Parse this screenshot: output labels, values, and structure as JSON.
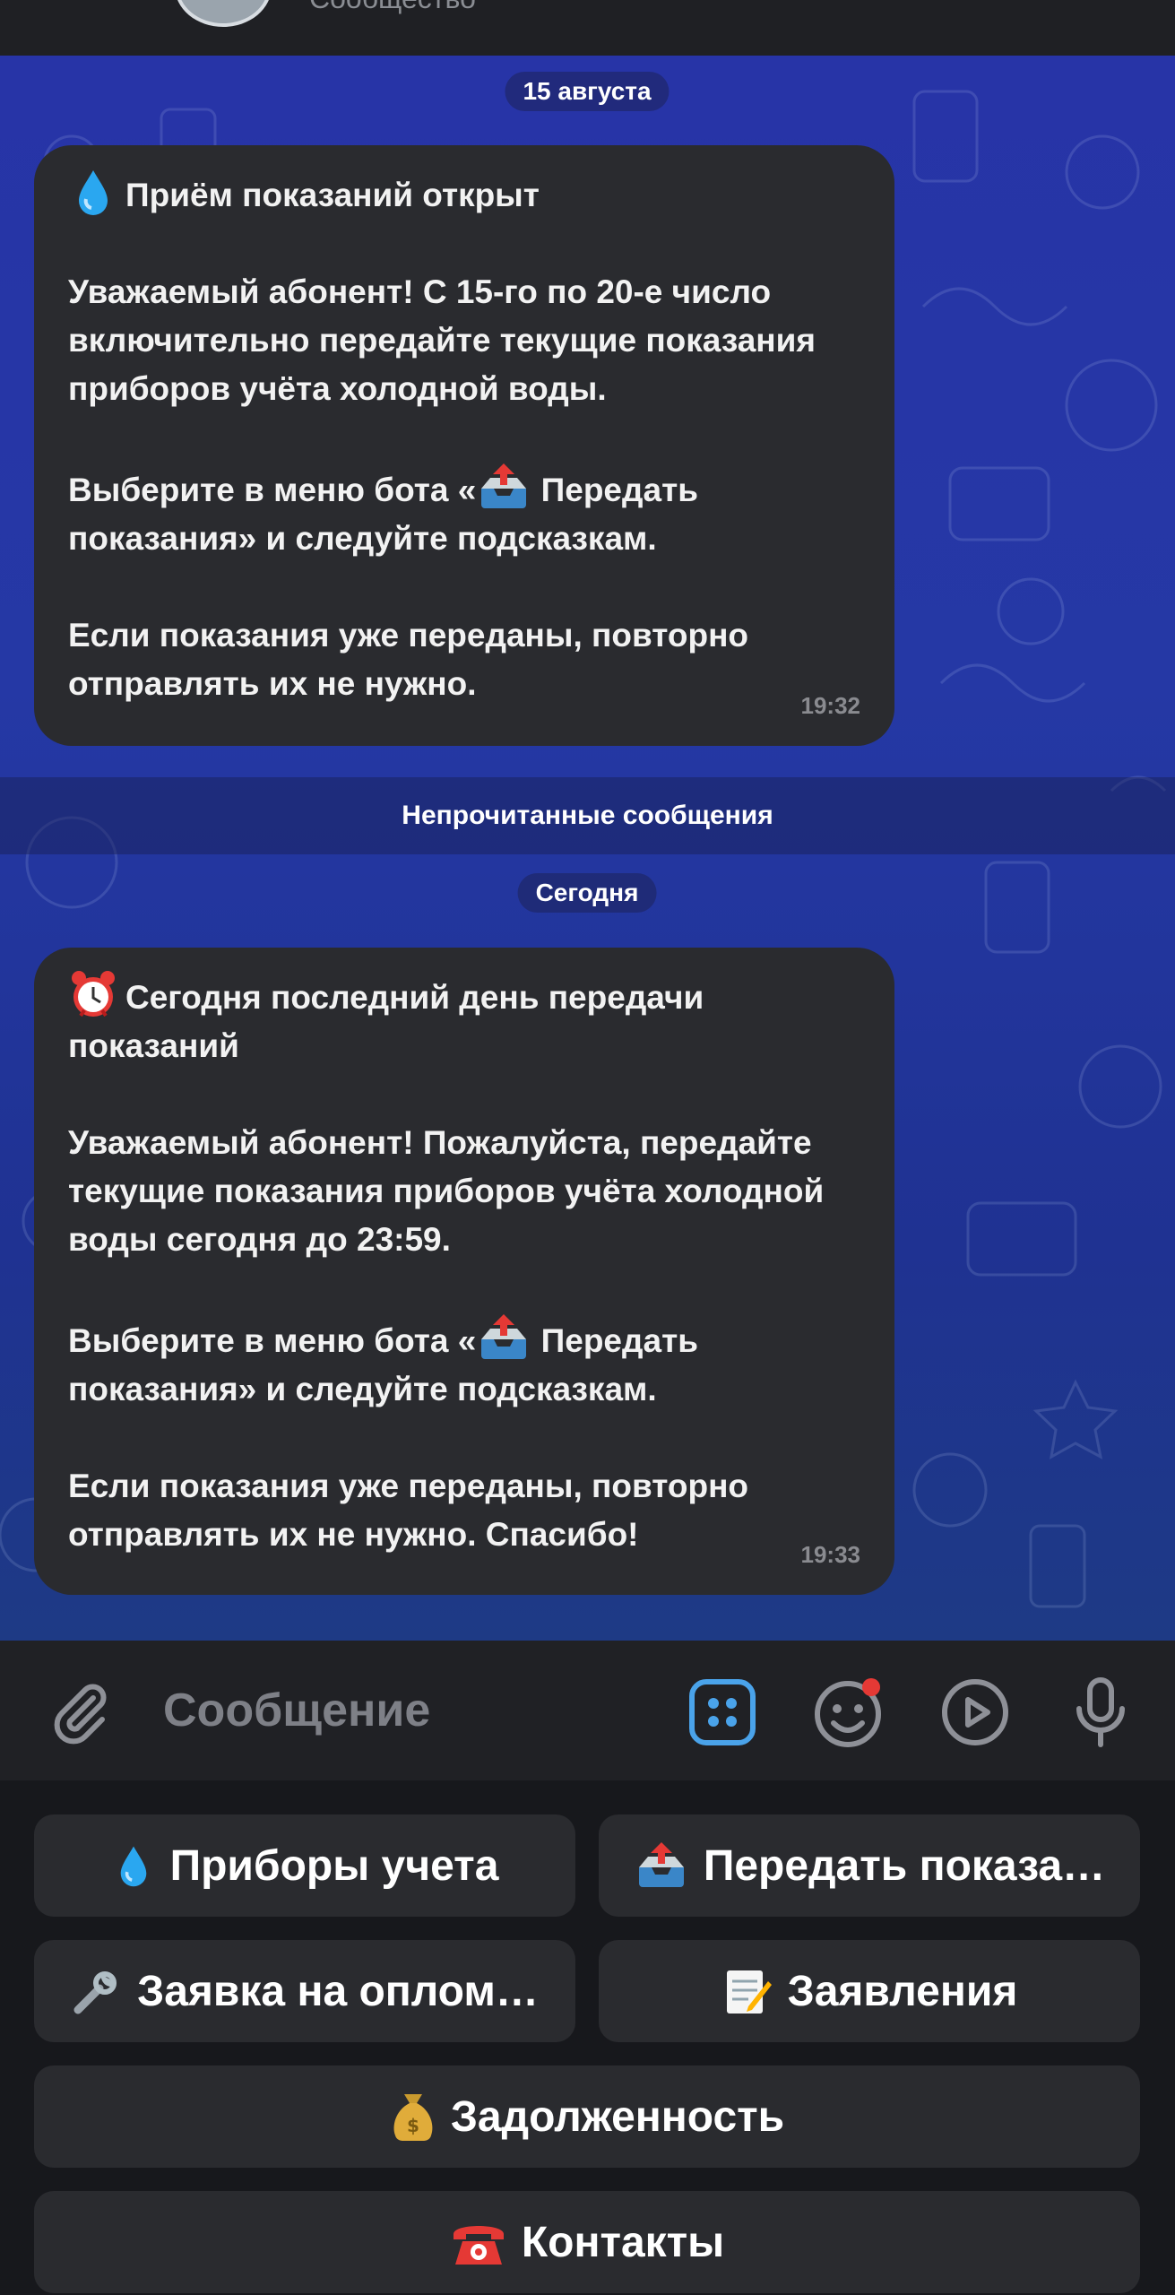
{
  "header": {
    "subtitle": "Сообщество"
  },
  "chat": {
    "date_1": "15 августа",
    "unread_label": "Непрочитанные сообщения",
    "date_2": "Сегодня",
    "messages": [
      {
        "title": "Приём показаний открыт",
        "title_emoji": "droplet-icon",
        "p1": "Уважаемый абонент! С 15-го по 20-е число включительно передайте текущие показания приборов учёта холодной воды.",
        "p2_before": "Выберите в меню бота «",
        "p2_after": " Передать показания» и следуйте подсказкам.",
        "p3": "Если показания уже переданы, повторно отправлять их не нужно.",
        "time": "19:32"
      },
      {
        "title": "Сегодня последний день передачи показаний",
        "title_emoji": "alarm-clock-icon",
        "p1": "Уважаемый абонент! Пожалуйста, передайте текущие показания приборов учёта холодной воды сегодня до 23:59.",
        "p2_before": "Выберите в меню бота «",
        "p2_after": " Передать показания» и следуйте подсказкам.",
        "p3": "Если показания уже переданы, повторно отправлять их не нужно. Спасибо!",
        "time": "19:33"
      }
    ]
  },
  "input": {
    "placeholder": "Сообщение"
  },
  "keyboard": {
    "buttons": [
      {
        "label": "Приборы учета",
        "icon": "droplet-icon"
      },
      {
        "label": "Передать показа…",
        "icon": "outbox-tray-icon"
      },
      {
        "label": "Заявка на оплом…",
        "icon": "wrench-icon"
      },
      {
        "label": "Заявления",
        "icon": "memo-icon"
      },
      {
        "label": "Задолженность",
        "icon": "money-bag-icon"
      },
      {
        "label": "Контакты",
        "icon": "telephone-icon"
      }
    ]
  },
  "colors": {
    "accent": "#4aa3ea",
    "bubble": "#2a2b2f",
    "notification_dot": "#e53935"
  }
}
